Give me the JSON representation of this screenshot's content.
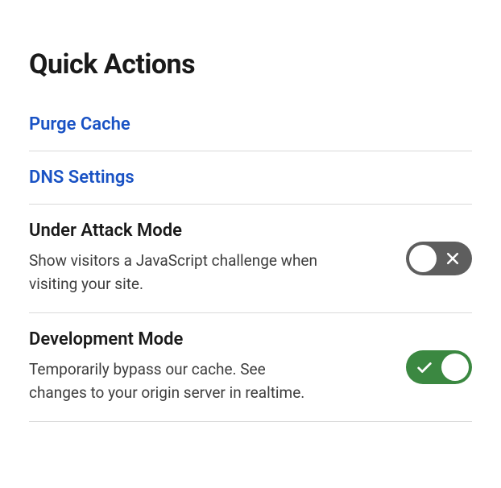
{
  "title": "Quick Actions",
  "links": {
    "purge_cache": "Purge Cache",
    "dns_settings": "DNS Settings"
  },
  "under_attack": {
    "title": "Under Attack Mode",
    "description": "Show visitors a JavaScript challenge when visiting your site.",
    "enabled": false
  },
  "development_mode": {
    "title": "Development Mode",
    "description": "Temporarily bypass our cache. See changes to your origin server in realtime.",
    "enabled": true
  },
  "colors": {
    "link": "#1952c4",
    "toggle_off": "#5e5e5e",
    "toggle_on": "#3b8841"
  }
}
